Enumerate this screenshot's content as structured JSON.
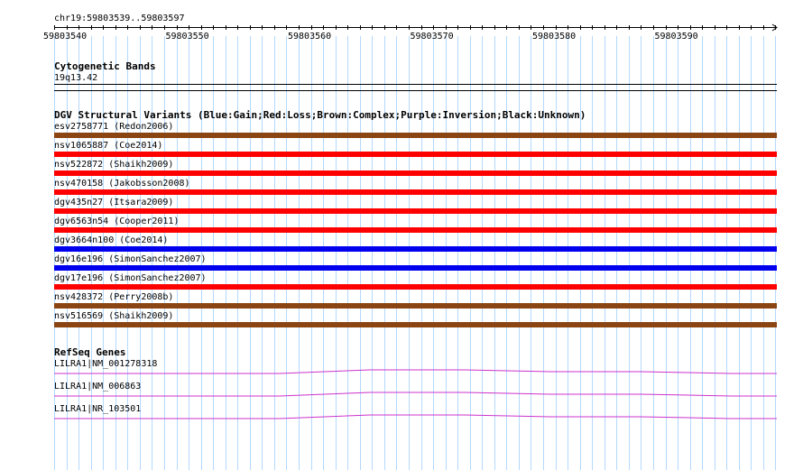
{
  "ruler": {
    "region": "chr19:59803539..59803597",
    "ticks": [
      "59803540",
      "59803550",
      "59803560",
      "59803570",
      "59803580",
      "59803590"
    ]
  },
  "cytoband": {
    "title": "Cytogenetic Bands",
    "band": "19q13.42"
  },
  "dgv": {
    "title": "DGV Structural Variants (Blue:Gain;Red:Loss;Brown:Complex;Purple:Inversion;Black:Unknown)",
    "colors": {
      "gain": "#0000ee",
      "loss": "#ff0000",
      "complex": "#8b4513"
    },
    "features": [
      {
        "label": "esv2758771 (Redon2006)",
        "type": "complex"
      },
      {
        "label": "nsv1065887 (Coe2014)",
        "type": "loss"
      },
      {
        "label": "nsv522872 (Shaikh2009)",
        "type": "loss"
      },
      {
        "label": "nsv470158 (Jakobsson2008)",
        "type": "loss"
      },
      {
        "label": "dgv435n27 (Itsara2009)",
        "type": "loss"
      },
      {
        "label": "dgv6563n54 (Cooper2011)",
        "type": "loss"
      },
      {
        "label": "dgv3664n100 (Coe2014)",
        "type": "gain"
      },
      {
        "label": "dgv16e196 (SimonSanchez2007)",
        "type": "gain"
      },
      {
        "label": "dgv17e196 (SimonSanchez2007)",
        "type": "loss"
      },
      {
        "label": "nsv428372 (Perry2008b)",
        "type": "complex"
      },
      {
        "label": "nsv516569 (Shaikh2009)",
        "type": "complex"
      }
    ]
  },
  "refseq": {
    "title": "RefSeq Genes",
    "line_color": "#cc33cc",
    "genes": [
      {
        "label": "LILRA1|NM_001278318"
      },
      {
        "label": "LILRA1|NM_006863"
      },
      {
        "label": "LILRA1|NR_103501"
      }
    ]
  }
}
